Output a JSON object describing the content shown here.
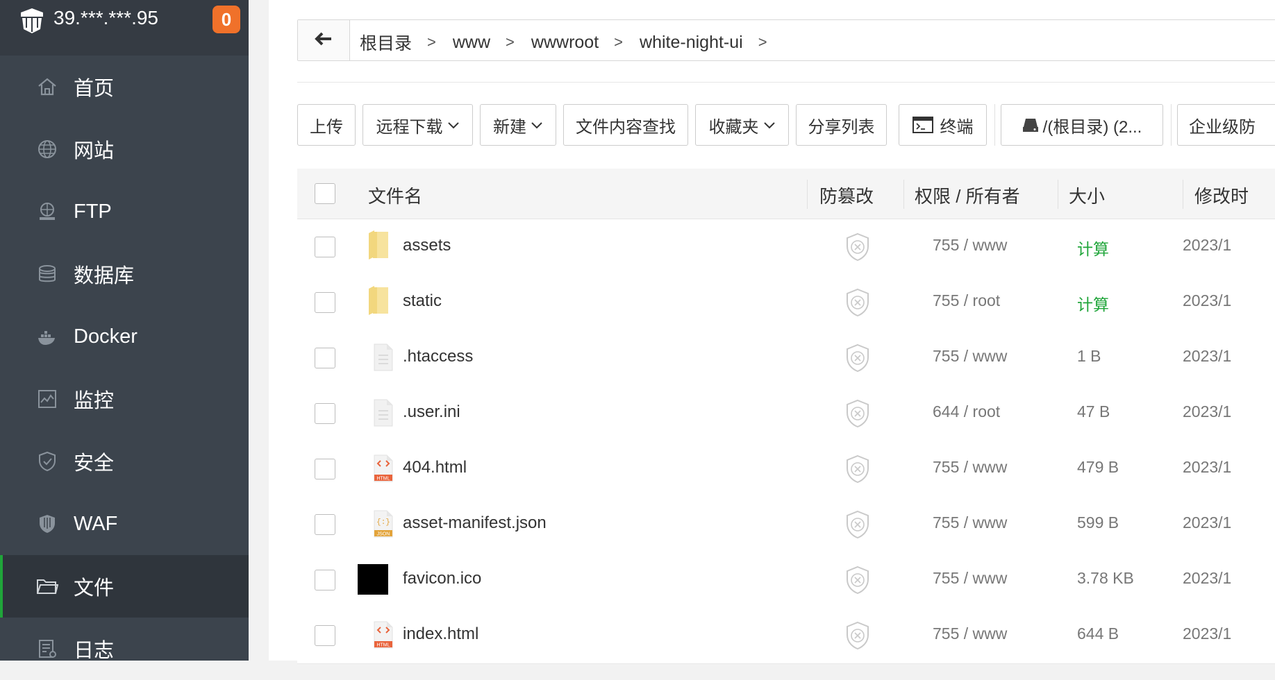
{
  "sidebar": {
    "server_ip": "39.***.***.95",
    "badge_count": "0",
    "items": [
      {
        "label": "首页",
        "icon": "home-icon"
      },
      {
        "label": "网站",
        "icon": "globe-icon"
      },
      {
        "label": "FTP",
        "icon": "ftp-icon"
      },
      {
        "label": "数据库",
        "icon": "database-icon"
      },
      {
        "label": "Docker",
        "icon": "docker-icon"
      },
      {
        "label": "监控",
        "icon": "monitor-icon"
      },
      {
        "label": "安全",
        "icon": "shield-icon"
      },
      {
        "label": "WAF",
        "icon": "waf-icon"
      },
      {
        "label": "文件",
        "icon": "folder-icon",
        "active": true
      },
      {
        "label": "日志",
        "icon": "log-icon"
      }
    ]
  },
  "breadcrumb": [
    "根目录",
    "www",
    "wwwroot",
    "white-night-ui"
  ],
  "toolbar": {
    "upload": "上传",
    "remote_download": "远程下载",
    "new": "新建",
    "search_content": "文件内容查找",
    "favorites": "收藏夹",
    "share_list": "分享列表",
    "terminal": "终端",
    "disk": "/(根目录) (2...",
    "enterprise": "企业级防"
  },
  "table": {
    "headers": {
      "name": "文件名",
      "tamper": "防篡改",
      "perm": "权限 / 所有者",
      "size": "大小",
      "mtime": "修改时"
    },
    "rows": [
      {
        "name": "assets",
        "type": "folder",
        "perm": "755 / www",
        "size": "计算",
        "mtime": "2023/1"
      },
      {
        "name": "static",
        "type": "folder",
        "perm": "755 / root",
        "size": "计算",
        "mtime": "2023/1"
      },
      {
        "name": ".htaccess",
        "type": "file",
        "perm": "755 / www",
        "size": "1 B",
        "mtime": "2023/1"
      },
      {
        "name": ".user.ini",
        "type": "file",
        "perm": "644 / root",
        "size": "47 B",
        "mtime": "2023/1"
      },
      {
        "name": "404.html",
        "type": "html",
        "perm": "755 / www",
        "size": "479 B",
        "mtime": "2023/1"
      },
      {
        "name": "asset-manifest.json",
        "type": "json",
        "perm": "755 / www",
        "size": "599 B",
        "mtime": "2023/1"
      },
      {
        "name": "favicon.ico",
        "type": "ico",
        "perm": "755 / www",
        "size": "3.78 KB",
        "mtime": "2023/1"
      },
      {
        "name": "index.html",
        "type": "html",
        "perm": "755 / www",
        "size": "644 B",
        "mtime": "2023/1"
      }
    ]
  },
  "colors": {
    "sidebar_bg": "#3c444d",
    "accent_green": "#20a53a",
    "badge_orange": "#f0712a"
  }
}
